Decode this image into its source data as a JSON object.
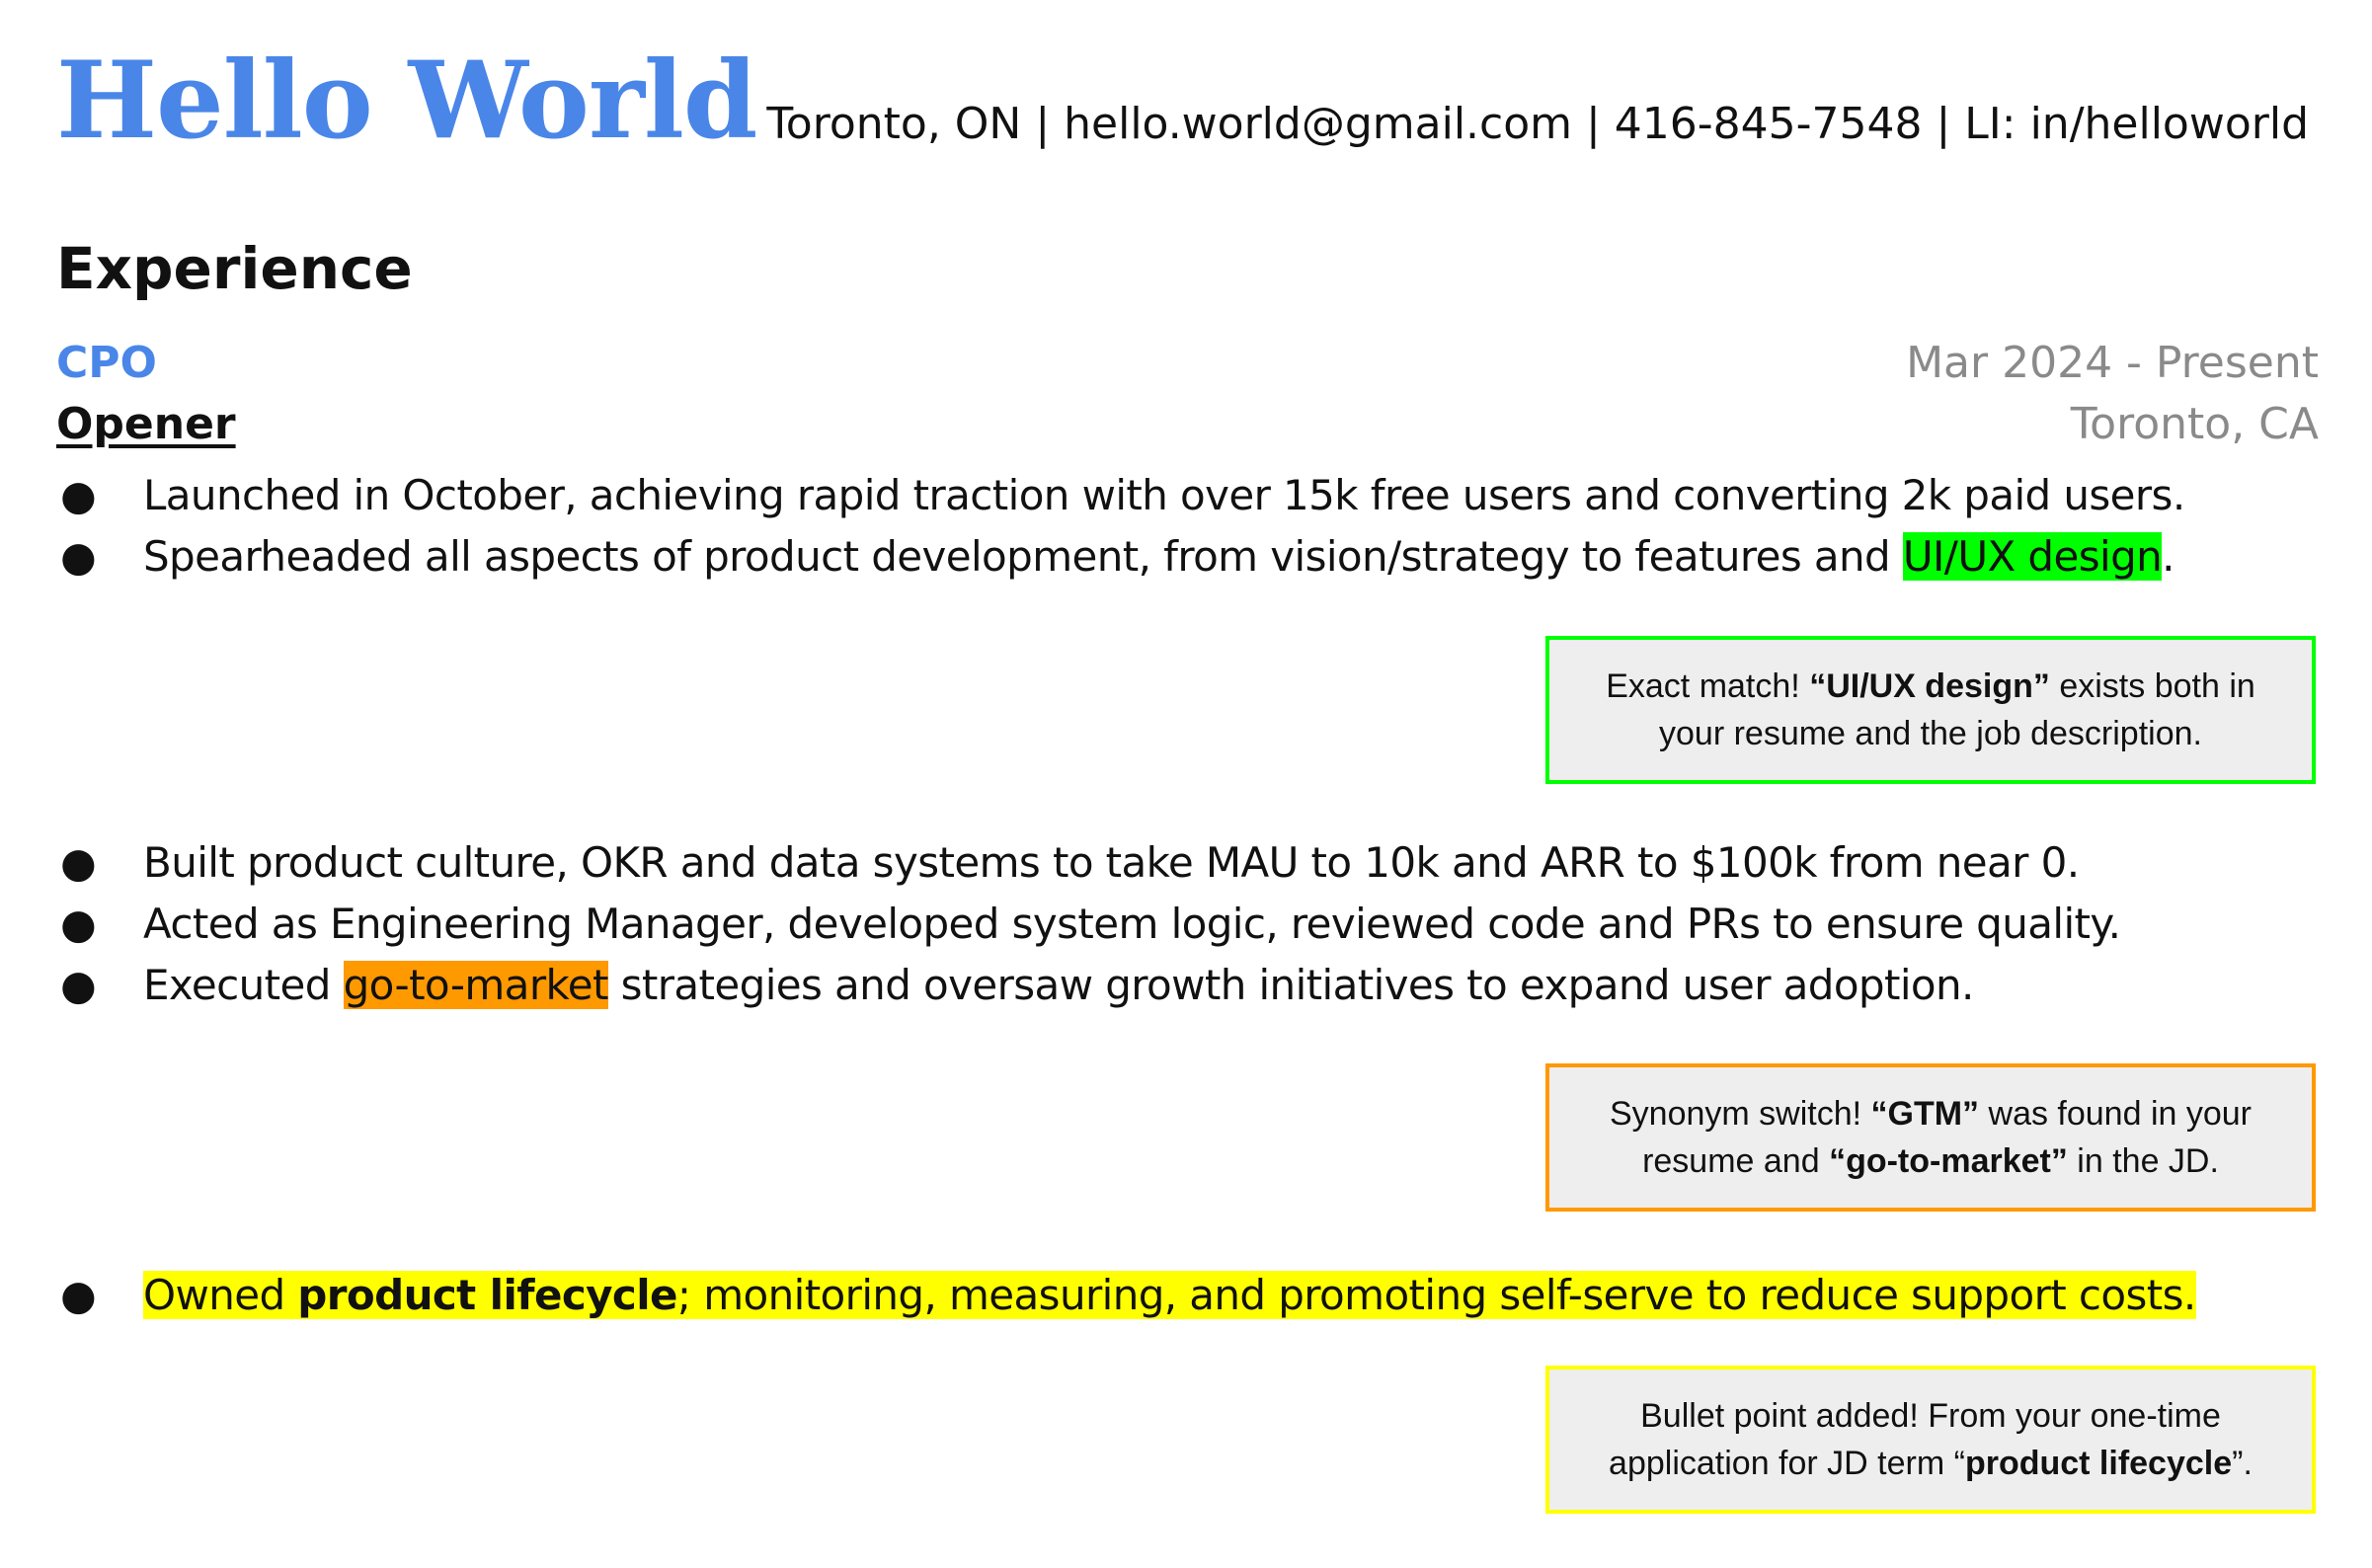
{
  "header": {
    "name": "Hello World",
    "contact": "Toronto, ON | hello.world@gmail.com | 416-845-7548 | LI: in/helloworld"
  },
  "experience": {
    "section_title": "Experience",
    "role": "CPO",
    "company": "Opener",
    "dates": "Mar 2024 - Present",
    "location": "Toronto, CA",
    "bullets_group_1": [
      {
        "text": "Launched in October, achieving rapid traction with over 15k free users and converting 2k paid users."
      },
      {
        "pre": "Spearheaded all aspects of product development, from vision/strategy to features and ",
        "highlight": "UI/UX design",
        "post": "."
      }
    ],
    "bullets_group_2": [
      {
        "text": "Built product culture, OKR and data systems to take MAU to 10k and ARR to $100k from near 0."
      },
      {
        "text": "Acted as Engineering Manager, developed system logic, reviewed code and PRs to ensure quality."
      },
      {
        "pre": "Executed ",
        "highlight": "go-to-market",
        "post": " strategies and oversaw growth initiatives to expand user adoption."
      }
    ],
    "bullets_group_3": [
      {
        "pre": "Owned ",
        "bold": "product lifecycle",
        "post": "; monitoring, measuring, and promoting self-serve to reduce support costs."
      }
    ],
    "bullet_symbol": "●"
  },
  "notes": {
    "exact_match": {
      "prefix": "Exact match! ",
      "term": "“UI/UX design”",
      "suffix": " exists both in your resume and the job description.",
      "border_color": "#00ff00"
    },
    "synonym_switch": {
      "prefix": "Synonym switch! ",
      "term1": "“GTM”",
      "middle": " was found in your resume and ",
      "term2": "“go-to-market”",
      "suffix": " in the JD.",
      "border_color": "#ff9900"
    },
    "bullet_added": {
      "prefix": "Bullet point added! From your one-time application for JD term “",
      "term": "product lifecycle",
      "suffix": "”.",
      "border_color": "#ffff00"
    }
  },
  "colors": {
    "accent_blue": "#4a86e8",
    "muted_gray": "#8a8a8a",
    "highlight_green": "#00ff00",
    "highlight_orange": "#ff9900",
    "highlight_yellow": "#ffff00",
    "note_background": "#eeeeee"
  }
}
